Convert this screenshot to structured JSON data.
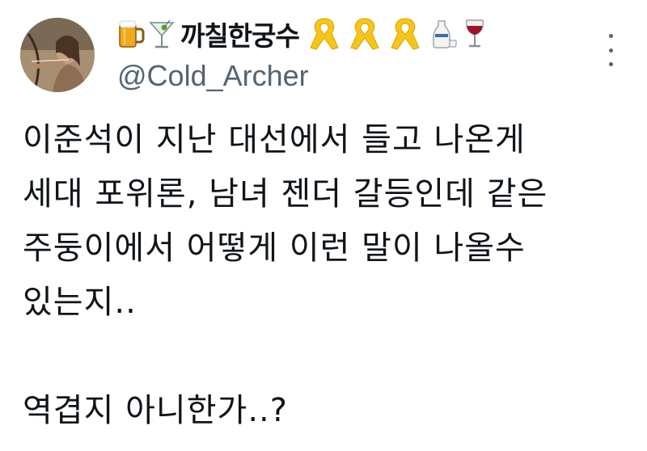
{
  "author": {
    "display_name": "까칠한궁수",
    "handle": "@Cold_Archer",
    "avatar_icon": "archer-avatar",
    "name_prefix_icons": [
      "beer-mug-icon",
      "cocktail-glass-icon"
    ],
    "ribbon_icons": [
      "yellow-ribbon-icon",
      "yellow-ribbon-icon",
      "yellow-ribbon-icon"
    ],
    "name_suffix_icons": [
      "sake-icon",
      "wine-glass-icon"
    ]
  },
  "menu": {
    "icon": "more-vertical-icon"
  },
  "tweet": {
    "lines": [
      "이준석이 지난 대선에서 들고 나온게",
      "세대 포위론, 남녀 젠더 갈등인데 같은",
      "주둥이에서 어떻게 이런 말이 나올수",
      "있는지..",
      "",
      "역겹지 아니한가..?"
    ]
  },
  "colors": {
    "text": "#0f1419",
    "secondary": "#536471",
    "ribbon": "#f5c518",
    "background": "#ffffff"
  }
}
